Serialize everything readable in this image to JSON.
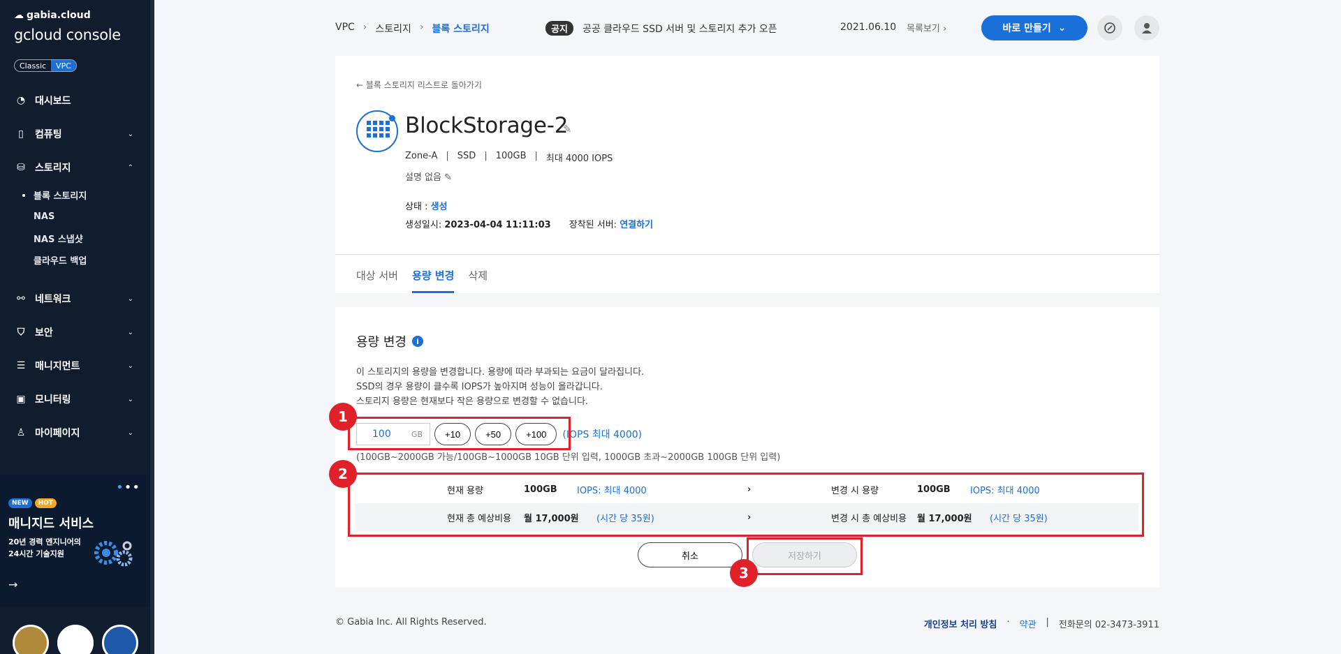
{
  "sidebar": {
    "brand_top": "gabia.cloud",
    "brand_main": "gcloud console",
    "env_classic": "Classic",
    "env_vpc": "VPC",
    "items": [
      {
        "label": "대시보드",
        "icon": "dashboard-icon"
      },
      {
        "label": "컴퓨팅",
        "icon": "chip-icon"
      },
      {
        "label": "스토리지",
        "icon": "storage-icon"
      },
      {
        "label": "네트워크",
        "icon": "network-icon"
      },
      {
        "label": "보안",
        "icon": "shield-icon"
      },
      {
        "label": "매니지먼트",
        "icon": "management-icon"
      },
      {
        "label": "모니터링",
        "icon": "monitor-icon"
      },
      {
        "label": "마이페이지",
        "icon": "user-icon"
      }
    ],
    "storage_sub": [
      "블록 스토리지",
      "NAS",
      "NAS 스냅샷",
      "클라우드 백업"
    ],
    "promo": {
      "badge_new": "NEW",
      "badge_hot": "HOT",
      "title": "매니지드 서비스",
      "line1": "20년 경력 엔지니어의",
      "line2": "24시간 기술지원"
    }
  },
  "header": {
    "breadcrumb": [
      "VPC",
      "스토리지",
      "블록 스토리지"
    ],
    "notice_tag": "공지",
    "notice_text": "공공 클라우드 SSD 서버 및 스토리지 추가 오픈",
    "notice_date": "2021.06.10",
    "notice_more": "목록보기",
    "create_button": "바로 만들기"
  },
  "detail": {
    "back_link": "블록 스토리지 리스트로 돌아가기",
    "title": "BlockStorage-2",
    "zone": "Zone-A",
    "type": "SSD",
    "size": "100GB",
    "iops": "최대 4000 IOPS",
    "description": "설명 없음",
    "status_label": "상태 :",
    "status_value": "생성",
    "created_label": "생성일시:",
    "created_value": "2023-04-04 11:11:03",
    "server_label": "장착된 서버:",
    "server_value": "연결하기",
    "tabs": [
      "대상 서버",
      "용량 변경",
      "삭제"
    ]
  },
  "resize": {
    "title": "용량 변경",
    "guide": [
      "이 스토리지의 용량을 변경합니다. 용량에 따라 부과되는 요금이 달라집니다.",
      "SSD의 경우 용량이 클수록 IOPS가 높아지며 성능이 올라갑니다.",
      "스토리지 용량은 현재보다 작은 용량으로 변경할 수 없습니다."
    ],
    "input_value": "100",
    "input_unit": "GB",
    "increments": [
      "+10",
      "+50",
      "+100"
    ],
    "iops_max": "(IOPS 최대 4000)",
    "range_note": "(100GB~2000GB 가능/100GB~1000GB 10GB 단위 입력, 1000GB 초과~2000GB 100GB 단위 입력)",
    "current_label": "현재 용량",
    "current_size": "100GB",
    "current_iops": "IOPS: 최대 4000",
    "after_label": "변경 시 용량",
    "after_size": "100GB",
    "after_iops": "IOPS: 최대 4000",
    "current_cost_label": "현재 총 예상비용",
    "current_cost": "월 17,000원",
    "current_hourly": "(시간 당 35원)",
    "after_cost_label": "변경 시 총 예상비용",
    "after_cost": "월 17,000원",
    "after_hourly": "(시간 당 35원)",
    "cancel_button": "취소",
    "save_button": "저장하기"
  },
  "annotations": [
    "1",
    "2",
    "3"
  ],
  "footer": {
    "copyright": "© Gabia Inc. All Rights Reserved.",
    "privacy": "개인정보 처리 방침",
    "terms": "약관",
    "phone_label": "전화문의",
    "phone": "02-3473-3911"
  },
  "colors": {
    "accent": "#1b6fd9",
    "sidebar": "#111d2e",
    "annotation": "#e0212a"
  }
}
